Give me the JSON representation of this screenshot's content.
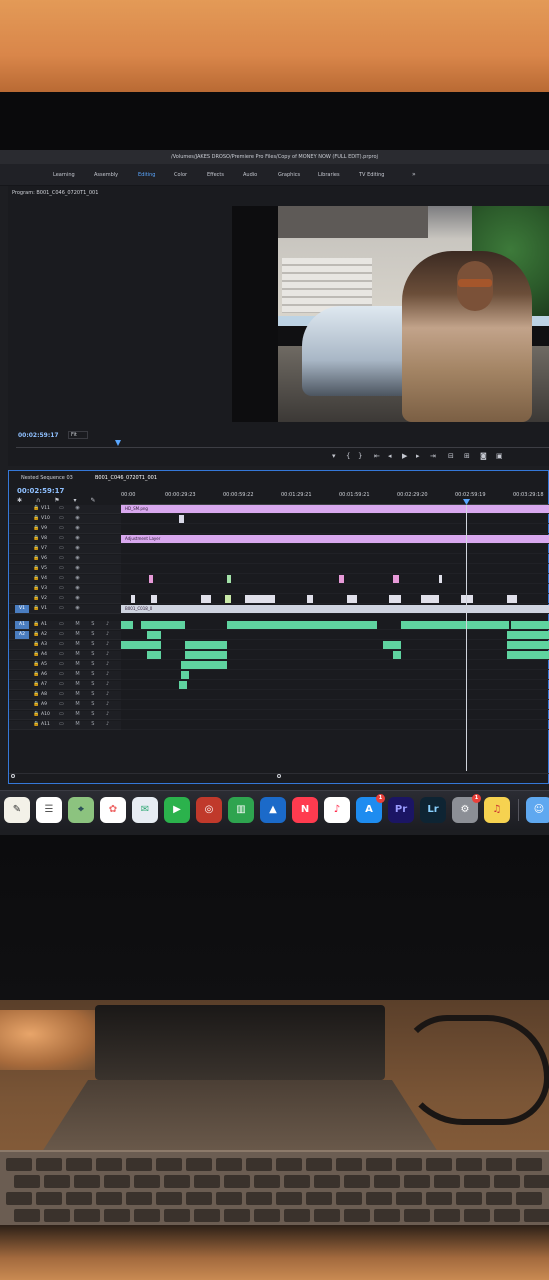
{
  "window": {
    "title": "/Volumes/JAKES DROSO/Premiere Pro Files/Copy of MONEY NOW (FULL EDIT).prproj"
  },
  "workspaces": [
    "Learning",
    "Assembly",
    "Editing",
    "Color",
    "Effects",
    "Audio",
    "Graphics",
    "Libraries",
    "TV Editing"
  ],
  "workspace_active": "Editing",
  "program_monitor": {
    "tab": "Program: B001_C046_0720T1_001",
    "timecode": "00:02:59:17",
    "zoom": "Fit"
  },
  "timeline": {
    "tabs": [
      "Nested Sequence 03",
      "B001_C046_0720T1_001"
    ],
    "active_tab": "B001_C046_0720T1_001",
    "timecode": "00:02:59:17",
    "ruler": [
      "00:00",
      "00:00:29:23",
      "00:00:59:22",
      "00:01:29:21",
      "00:01:59:21",
      "00:02:29:20",
      "00:02:59:19",
      "00:03:29:18"
    ],
    "video_tracks": [
      "V11",
      "V10",
      "V9",
      "V8",
      "V7",
      "V6",
      "V5",
      "V4",
      "V3",
      "V2",
      "V1"
    ],
    "audio_tracks": [
      "A1",
      "A2",
      "A3",
      "A4",
      "A5",
      "A6",
      "A7",
      "A8",
      "A9",
      "A10",
      "A11"
    ],
    "clips": {
      "top_png": "HD_SM.png",
      "adjustment": "Adjustment Layer",
      "v1_clip": "B001_C018_0"
    }
  },
  "dock": {
    "apps": [
      "Notes",
      "Reminders",
      "Maps",
      "Photos",
      "Messages",
      "FaceTime",
      "Photo Booth",
      "Numbers",
      "Keynote",
      "News",
      "Music",
      "App Store",
      "Pr",
      "Lr",
      "System Preferences",
      "iTunes",
      "Finder"
    ],
    "badges": {
      "App Store": "1",
      "System Preferences": "1"
    }
  },
  "colors": {
    "accent": "#5aa7ff",
    "clip_purple": "#d8a8ee",
    "clip_green": "#5fd3a0",
    "clip_pink": "#e79ad8"
  }
}
